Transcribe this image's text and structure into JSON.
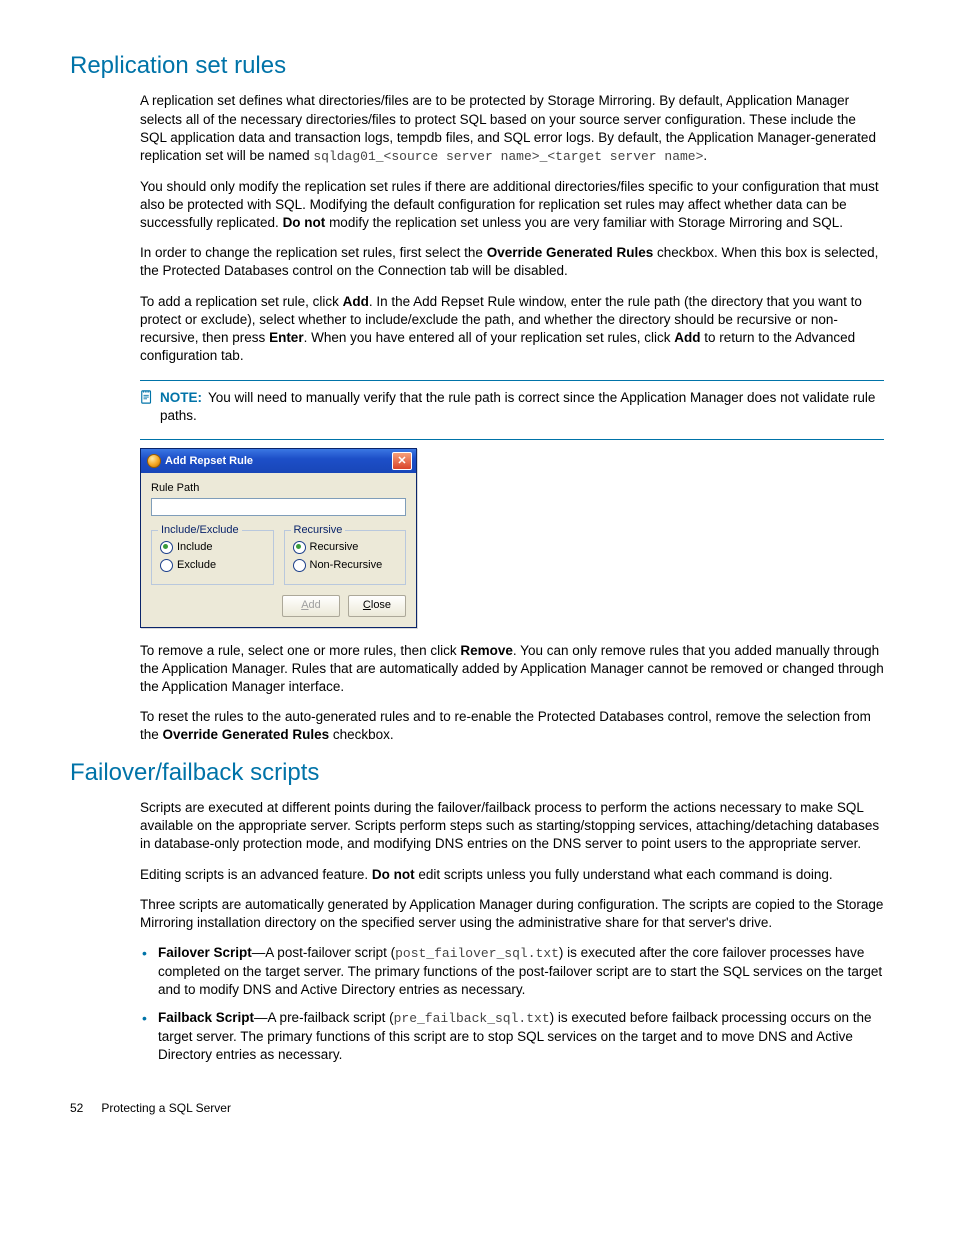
{
  "section1": {
    "heading": "Replication set rules",
    "p1a": "A replication set defines what directories/files are to be protected by Storage Mirroring. By default, Application Manager selects all of the necessary directories/files to protect SQL based on your source server configuration. These include the SQL application data and transaction logs, tempdb files, and SQL error logs. By default, the Application Manager-generated replication set will be named ",
    "p1code": "sqldag01_<source server name>_<target server name>",
    "p1b": ".",
    "p2a": "You should only modify the replication set rules if there are additional directories/files specific to your configuration that must also be protected with SQL. Modifying the default configuration for replication set rules may affect whether data can be successfully replicated. ",
    "p2bold": "Do not",
    "p2b": " modify the replication set unless you are very familiar with Storage Mirroring and SQL.",
    "p3a": "In order to change the replication set rules, first select the ",
    "p3bold": "Override Generated Rules",
    "p3b": " checkbox. When this box is selected, the Protected Databases control on the Connection tab will be disabled.",
    "p4a": "To add a replication set rule, click ",
    "p4bold1": "Add",
    "p4b": ". In the Add Repset Rule window, enter the rule path (the directory that you want to protect or exclude), select whether to include/exclude the path, and whether the directory should be recursive or non-recursive, then press ",
    "p4bold2": "Enter",
    "p4c": ". When you have entered all of your replication set rules, click ",
    "p4bold3": "Add",
    "p4d": " to return to the Advanced configuration tab.",
    "note_label": "NOTE:",
    "note_text": "You will need to manually verify that the rule path is correct since the Application Manager does not validate rule paths.",
    "p5a": "To remove a rule, select one or more rules, then click ",
    "p5bold": "Remove",
    "p5b": ". You can only remove rules that you added manually through the Application Manager. Rules that are automatically added by Application Manager cannot be removed or changed through the Application Manager interface.",
    "p6a": "To reset the rules to the auto-generated rules and to re-enable the Protected Databases control, remove the selection from the ",
    "p6bold": "Override Generated Rules",
    "p6b": " checkbox."
  },
  "dialog": {
    "title": "Add Repset Rule",
    "rule_path_label": "Rule Path",
    "group1_legend": "Include/Exclude",
    "g1_opt1": "Include",
    "g1_opt2": "Exclude",
    "group2_legend": "Recursive",
    "g2_opt1": "Recursive",
    "g2_opt2": "Non-Recursive",
    "add_btn": "Add",
    "close_btn": "Close"
  },
  "section2": {
    "heading": "Failover/failback scripts",
    "p1": "Scripts are executed at different points during the failover/failback process to perform the actions necessary to make SQL available on the appropriate server. Scripts perform steps such as starting/stopping services, attaching/detaching databases in database-only protection mode, and modifying DNS entries on the DNS server to point users to the appropriate server.",
    "p2a": "Editing scripts is an advanced feature. ",
    "p2bold": "Do not",
    "p2b": " edit scripts unless you fully understand what each command is doing.",
    "p3": "Three scripts are automatically generated by Application Manager during configuration. The scripts are copied to the Storage Mirroring installation directory on the specified server using the administrative share for that server's drive.",
    "li1_bold": "Failover Script",
    "li1_a": "—A post-failover script (",
    "li1_code": "post_failover_sql.txt",
    "li1_b": ") is executed after the core failover processes have completed on the target server. The primary functions of the post-failover script are to start the SQL services on the target and to modify DNS and Active Directory entries as necessary.",
    "li2_bold": "Failback Script",
    "li2_a": "—A pre-failback script (",
    "li2_code": "pre_failback_sql.txt",
    "li2_b": ") is executed before failback processing occurs on the target server. The primary functions of this script are to stop SQL services on the target and to move DNS and Active Directory entries as necessary."
  },
  "footer": {
    "page": "52",
    "title": "Protecting a SQL Server"
  }
}
